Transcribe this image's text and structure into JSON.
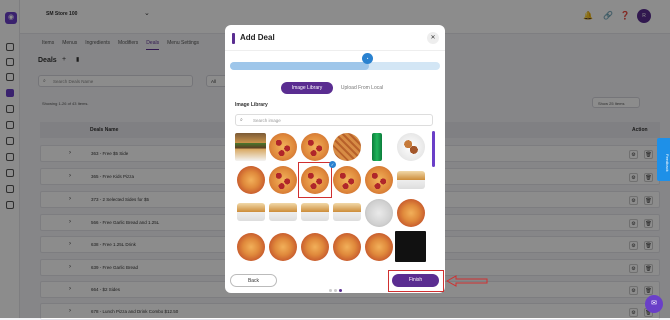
{
  "topbar": {
    "store": "SM Store 100",
    "avatar": "R"
  },
  "tabs": [
    {
      "label": "Items"
    },
    {
      "label": "Menus"
    },
    {
      "label": "Ingredients"
    },
    {
      "label": "Modifiers"
    },
    {
      "label": "Deals"
    },
    {
      "label": "Menu Settings"
    }
  ],
  "deals": {
    "title": "Deals",
    "add": "+",
    "search_placeholder": "Search Deals Name",
    "filter": "All",
    "showing": "Showing 1-26 of 43 Items.",
    "show_select": "Show 25 Items",
    "col_name": "Deals Name",
    "col_action": "Action"
  },
  "rows": [
    "363 - Free $5 Side",
    "365 - Free Kids Pizza",
    "373 - 2 Selected Sides for $5",
    "566 - Free Garlic Bread and 1.25L",
    "638 - Free 1.25L Drink",
    "639 - Free Garlic Bread",
    "664 - $2 Sides",
    "678 - Lunch Pizza and Drink Combo $12.50"
  ],
  "feedback": "Feedback",
  "modal": {
    "title": "Add Deal",
    "progress": 0.66,
    "tab_library": "Image Library",
    "tab_local": "Upload From Local",
    "library_label": "Image Library",
    "search_placeholder": "Search image",
    "back": "Back",
    "finish": "Finish",
    "page_dots": 3,
    "active_dot": 3
  },
  "colors": {
    "primary": "#5a2d91",
    "highlight": "#d03030",
    "accent": "#2a82d0"
  }
}
